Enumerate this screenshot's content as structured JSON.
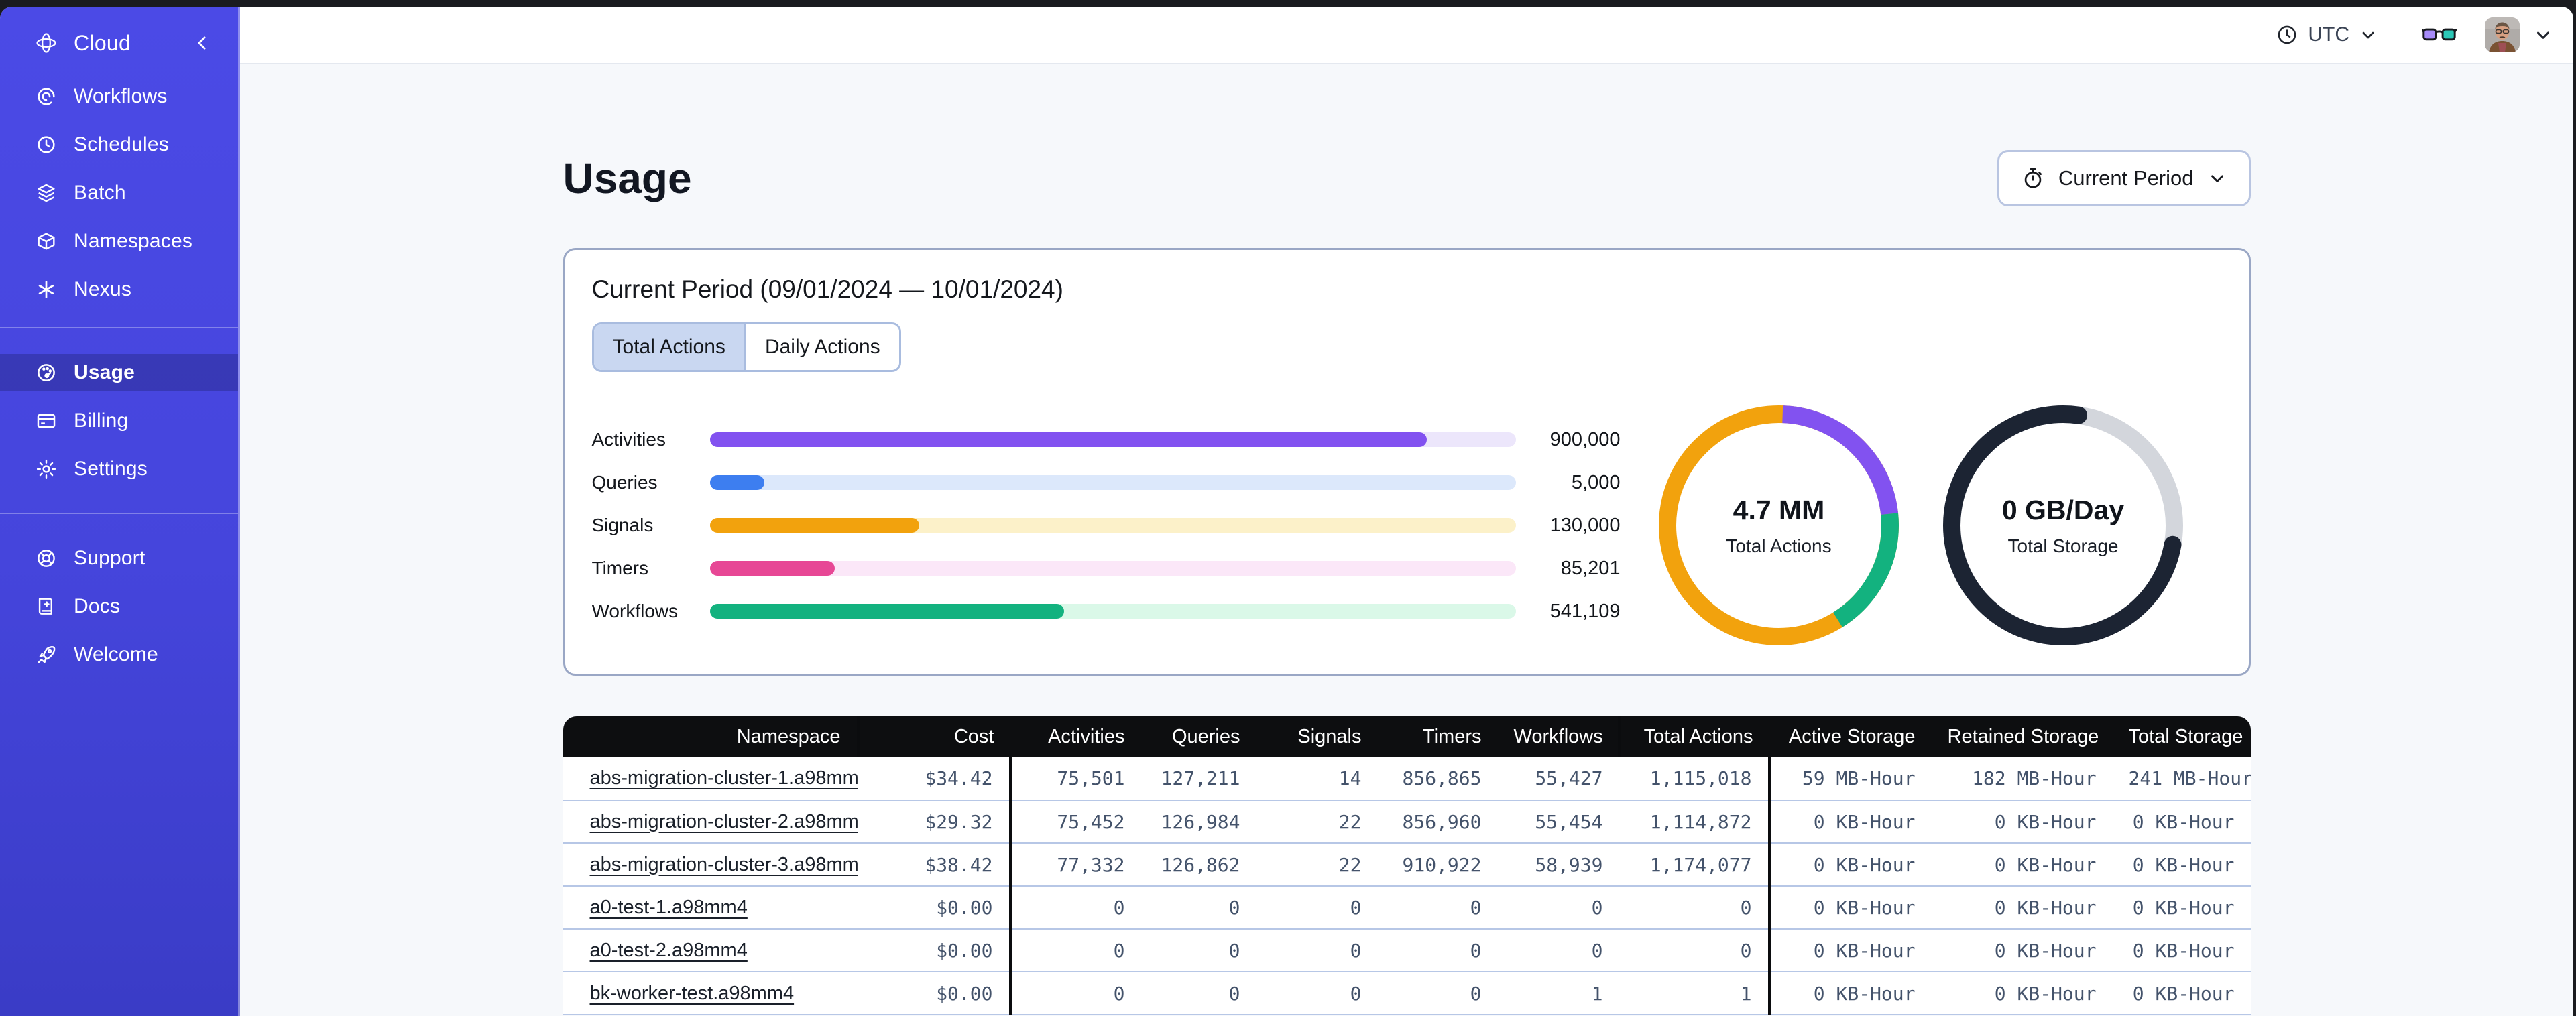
{
  "topbar": {
    "timezone": {
      "label": "UTC"
    }
  },
  "sidebar": {
    "brand": {
      "label": "Cloud"
    },
    "nav": [
      {
        "label": "Workflows",
        "icon": "#i-workflows",
        "name": "sidebar-item-workflows",
        "icon_name": "workflows-icon"
      },
      {
        "label": "Schedules",
        "icon": "#i-schedules",
        "name": "sidebar-item-schedules",
        "icon_name": "schedules-icon"
      },
      {
        "label": "Batch",
        "icon": "#i-batch",
        "name": "sidebar-item-batch",
        "icon_name": "batch-layers-icon"
      },
      {
        "label": "Namespaces",
        "icon": "#i-namespaces",
        "name": "sidebar-item-namespaces",
        "icon_name": "namespaces-cube-icon"
      },
      {
        "label": "Nexus",
        "icon": "#i-nexus",
        "name": "sidebar-item-nexus",
        "icon_name": "nexus-asterisk-icon"
      }
    ],
    "account": [
      {
        "label": "Usage",
        "icon": "#i-usage",
        "active": true,
        "name": "sidebar-item-usage",
        "icon_name": "usage-gauge-icon"
      },
      {
        "label": "Billing",
        "icon": "#i-billing",
        "name": "sidebar-item-billing",
        "icon_name": "billing-card-icon"
      },
      {
        "label": "Settings",
        "icon": "#i-settings",
        "name": "sidebar-item-settings",
        "icon_name": "settings-gear-icon"
      }
    ],
    "footer": [
      {
        "label": "Support",
        "icon": "#i-support",
        "name": "sidebar-item-support",
        "icon_name": "support-lifebuoy-icon"
      },
      {
        "label": "Docs",
        "icon": "#i-docs",
        "name": "sidebar-item-docs",
        "icon_name": "docs-book-icon"
      },
      {
        "label": "Welcome",
        "icon": "#i-welcome",
        "name": "sidebar-item-welcome",
        "icon_name": "welcome-rocket-icon"
      }
    ]
  },
  "page": {
    "title": "Usage",
    "period_selector": {
      "label": "Current Period"
    }
  },
  "panel": {
    "title": "Current Period (09/01/2024 — 10/01/2024)",
    "tabs": [
      {
        "label": "Total Actions",
        "active": true,
        "name": "tab-total-actions"
      },
      {
        "label": "Daily Actions",
        "active": false,
        "name": "tab-daily-actions"
      }
    ]
  },
  "chart_data": {
    "type": "bar",
    "title": "Current period usage by action type",
    "categories": [
      "Activities",
      "Queries",
      "Signals",
      "Timers",
      "Workflows"
    ],
    "values": [
      900000,
      5000,
      130000,
      85201,
      541109
    ],
    "bars": [
      {
        "label": "Activities",
        "value": 900000,
        "value_label": "900,000",
        "fill_pct": "89%",
        "color": "#8252F0",
        "track": "#ECE6FB",
        "name": "bar-row-activities"
      },
      {
        "label": "Queries",
        "value": 5000,
        "value_label": "5,000",
        "fill_pct": "6.8%",
        "color": "#3D7EF0",
        "track": "#DCE8FB",
        "name": "bar-row-queries"
      },
      {
        "label": "Signals",
        "value": 130000,
        "value_label": "130,000",
        "fill_pct": "26%",
        "color": "#F2A20D",
        "track": "#FCF1C9",
        "name": "bar-row-signals"
      },
      {
        "label": "Timers",
        "value": 85201,
        "value_label": "85,201",
        "fill_pct": "15.5%",
        "color": "#E74795",
        "track": "#FBE7F8",
        "name": "bar-row-timers"
      },
      {
        "label": "Workflows",
        "value": 541109,
        "value_label": "541,109",
        "fill_pct": "44%",
        "color": "#13B27F",
        "track": "#DAF8E8",
        "name": "bar-row-workflows"
      }
    ],
    "donuts": [
      {
        "value": "4.7 MM",
        "label": "Total Actions",
        "name": "total-actions-donut",
        "segments": [
          {
            "color": "#F2A20D",
            "from": 0,
            "to": 360
          },
          {
            "color": "#8252F0",
            "from": 2,
            "to": 84
          },
          {
            "color": "#13B27F",
            "from": 84,
            "to": 148
          }
        ]
      },
      {
        "value": "0 GB/Day",
        "label": "Total Storage",
        "name": "total-storage-donut",
        "segments": [
          {
            "color": "#D3D6DC",
            "from": 0,
            "to": 360
          },
          {
            "color": "#1C2433",
            "from": 100,
            "to": 368,
            "cap": "round"
          }
        ]
      }
    ]
  },
  "table": {
    "columns": [
      "Namespace",
      "Cost",
      "Activities",
      "Queries",
      "Signals",
      "Timers",
      "Workflows",
      "Total Actions",
      "Active Storage",
      "Retained Storage",
      "Total Storage"
    ],
    "rows": [
      {
        "namespace": "abs-migration-cluster-1.a98mm4",
        "cells": [
          "$34.42",
          "75,501",
          "127,211",
          "14",
          "856,865",
          "55,427",
          "1,115,018",
          "59 MB-Hour",
          "182 MB-Hour",
          "241 MB-Hour"
        ]
      },
      {
        "namespace": "abs-migration-cluster-2.a98mm4",
        "cells": [
          "$29.32",
          "75,452",
          "126,984",
          "22",
          "856,960",
          "55,454",
          "1,114,872",
          "0 KB-Hour",
          "0 KB-Hour",
          "0 KB-Hour"
        ]
      },
      {
        "namespace": "abs-migration-cluster-3.a98mm4",
        "cells": [
          "$38.42",
          "77,332",
          "126,862",
          "22",
          "910,922",
          "58,939",
          "1,174,077",
          "0 KB-Hour",
          "0 KB-Hour",
          "0 KB-Hour"
        ]
      },
      {
        "namespace": "a0-test-1.a98mm4",
        "cells": [
          "$0.00",
          "0",
          "0",
          "0",
          "0",
          "0",
          "0",
          "0 KB-Hour",
          "0 KB-Hour",
          "0 KB-Hour"
        ]
      },
      {
        "namespace": "a0-test-2.a98mm4",
        "cells": [
          "$0.00",
          "0",
          "0",
          "0",
          "0",
          "0",
          "0",
          "0 KB-Hour",
          "0 KB-Hour",
          "0 KB-Hour"
        ]
      },
      {
        "namespace": "bk-worker-test.a98mm4",
        "cells": [
          "$0.00",
          "0",
          "0",
          "0",
          "0",
          "1",
          "1",
          "0 KB-Hour",
          "0 KB-Hour",
          "0 KB-Hour"
        ]
      }
    ]
  }
}
